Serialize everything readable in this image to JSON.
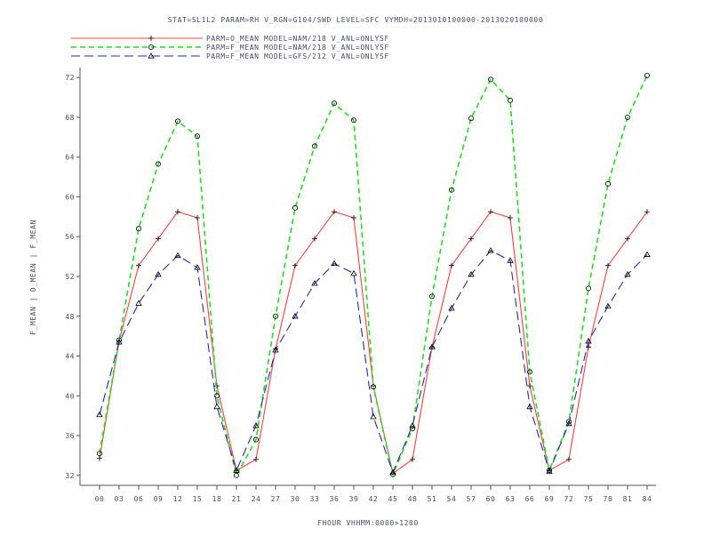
{
  "chart_data": {
    "type": "line",
    "title": "STAT=SL1L2 PARAM=RH V_RGN=G104/SWD LEVEL=SFC VYMDH=2013010100000-2013020100000",
    "xlabel": "FHOUR VHHMM:0000>1200",
    "ylabel": "F_MEAN | O_MEAN | F_MEAN",
    "categories": [
      "00",
      "03",
      "06",
      "09",
      "12",
      "15",
      "18",
      "21",
      "24",
      "27",
      "30",
      "33",
      "36",
      "39",
      "42",
      "45",
      "48",
      "51",
      "54",
      "57",
      "60",
      "63",
      "66",
      "69",
      "72",
      "75",
      "78",
      "81",
      "84"
    ],
    "ylim": [
      31,
      73
    ],
    "yticks": [
      "32",
      "36",
      "40",
      "44",
      "48",
      "52",
      "56",
      "60",
      "64",
      "68",
      "72"
    ],
    "grid": false,
    "legend_position": "top-left",
    "series": [
      {
        "name": "PARM=O_MEAN MODEL=NAM/218 V_ANL=ONLYSF",
        "color": "#ff4040",
        "dash": "solid",
        "marker": "plus",
        "values": [
          33.7,
          45.5,
          53.1,
          55.8,
          58.5,
          57.9,
          41.0,
          32.5,
          33.6,
          44.7,
          53.1,
          55.8,
          58.5,
          57.9,
          41.0,
          32.2,
          33.6,
          44.9,
          53.1,
          55.8,
          58.5,
          57.9,
          41.0,
          32.5,
          33.6,
          44.9,
          53.1,
          55.8,
          58.5
        ]
      },
      {
        "name": "PARM=F_MEAN MODEL=NAM/218 V_ANL=ONLYSF",
        "color": "#22dd22",
        "dash": "short",
        "marker": "circle",
        "values": [
          34.2,
          45.6,
          56.8,
          63.3,
          67.6,
          66.1,
          40.0,
          32.0,
          35.6,
          48.0,
          58.9,
          65.1,
          69.4,
          67.7,
          40.9,
          32.1,
          36.7,
          50.0,
          60.7,
          67.9,
          71.8,
          69.7,
          42.4,
          32.5,
          37.4,
          50.8,
          61.3,
          68.0,
          72.2
        ]
      },
      {
        "name": "PARM=F_MEAN MODEL=GFS/212 V_ANL=ONLYSF",
        "color": "#2a2aa8",
        "dash": "long",
        "marker": "triangle",
        "values": [
          38.1,
          45.4,
          49.3,
          52.2,
          54.1,
          52.9,
          38.9,
          32.5,
          37.0,
          44.6,
          48.0,
          51.3,
          53.3,
          52.3,
          37.9,
          32.3,
          37.0,
          44.9,
          48.8,
          52.2,
          54.6,
          53.6,
          38.9,
          32.4,
          37.2,
          45.5,
          49.0,
          52.2,
          54.2
        ]
      }
    ]
  }
}
